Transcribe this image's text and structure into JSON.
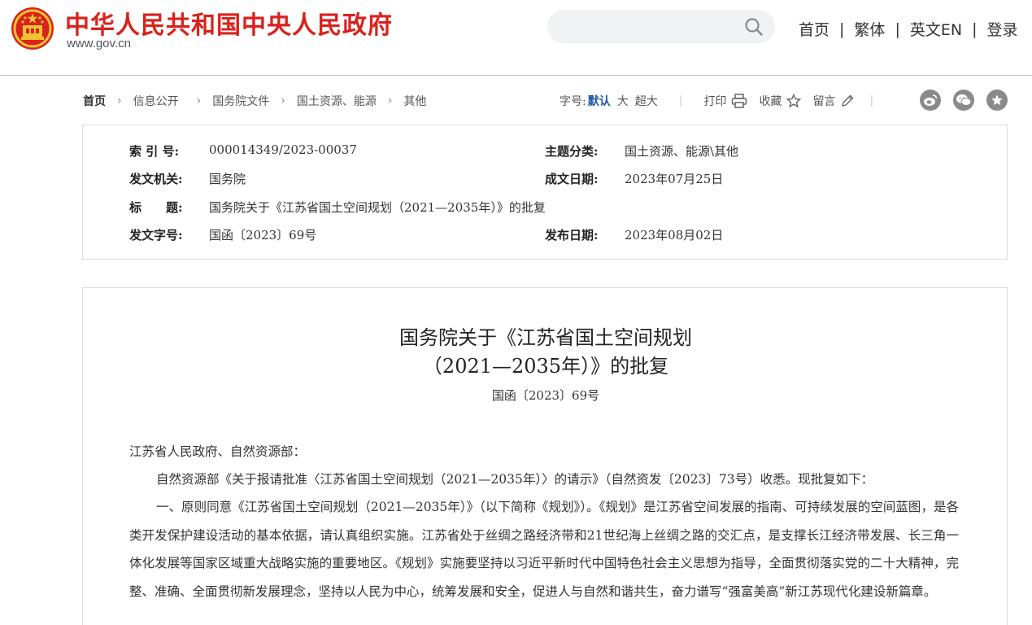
{
  "header": {
    "site_title": "中华人民共和国中央人民政府",
    "site_domain": "www.gov.cn",
    "search": {
      "placeholder": ""
    },
    "nav": [
      "首页",
      "繁体",
      "英文EN",
      "登录"
    ],
    "accent_color": "#d9221c"
  },
  "breadcrumb": [
    "首页",
    "信息公开",
    "国务院文件",
    "国土资源、能源",
    "其他"
  ],
  "tools": {
    "font_size_label": "字号:",
    "font_sizes": [
      "默认",
      "大",
      "超大"
    ],
    "print": "打印",
    "favorite": "收藏",
    "comment": "留言",
    "share_icons": [
      "weibo-icon",
      "wechat-icon",
      "star-icon"
    ]
  },
  "info": {
    "index_label": "索 引 号:",
    "index_value": "000014349/2023-00037",
    "category_label": "主题分类:",
    "category_value": "国土资源、能源\\其他",
    "issuer_label": "发文机关:",
    "issuer_value": "国务院",
    "created_label": "成文日期:",
    "created_value": "2023年07月25日",
    "title_label": "标　　题:",
    "title_value": "国务院关于《江苏省国土空间规划（2021—2035年）》的批复",
    "doc_no_label": "发文字号:",
    "doc_no_value": "国函〔2023〕69号",
    "published_label": "发布日期:",
    "published_value": "2023年08月02日"
  },
  "document": {
    "title_line1": "国务院关于《江苏省国土空间规划",
    "title_line2": "（2021—2035年）》的批复",
    "doc_no": "国函〔2023〕69号",
    "addressee": "江苏省人民政府、自然资源部：",
    "para1": "自然资源部《关于报请批准〈江苏省国土空间规划（2021—2035年）〉的请示》（自然资发〔2023〕73号）收悉。现批复如下：",
    "para2": "一、原则同意《江苏省国土空间规划（2021—2035年）》（以下简称《规划》）。《规划》是江苏省空间发展的指南、可持续发展的空间蓝图，是各类开发保护建设活动的基本依据，请认真组织实施。江苏省处于丝绸之路经济带和21世纪海上丝绸之路的交汇点，是支撑长江经济带发展、长三角一体化发展等国家区域重大战略实施的重要地区。《规划》实施要坚持以习近平新时代中国特色社会主义思想为指导，全面贯彻落实党的二十大精神，完整、准确、全面贯彻新发展理念，坚持以人民为中心，统筹发展和安全，促进人与自然和谐共生，奋力谱写“强富美高”新江苏现代化建设新篇章。"
  }
}
